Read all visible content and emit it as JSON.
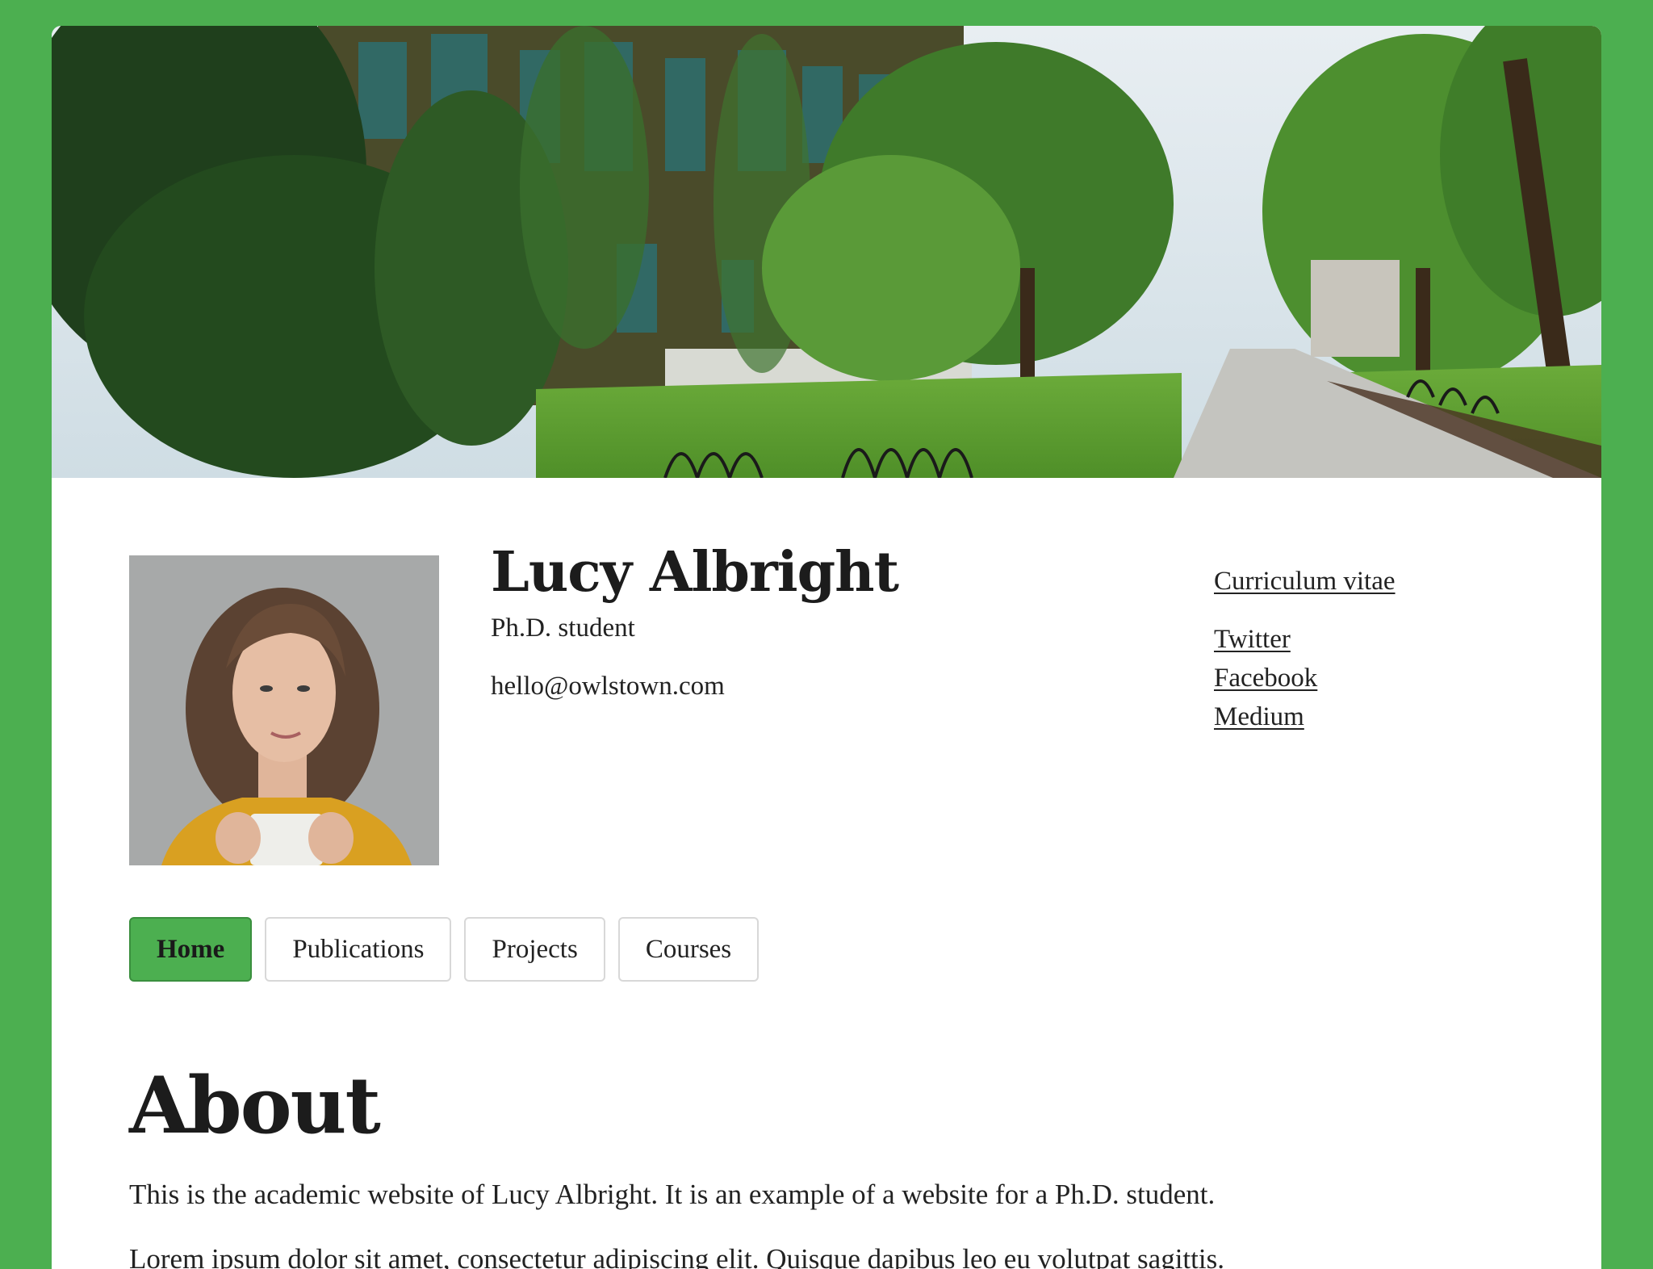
{
  "profile": {
    "name": "Lucy Albright",
    "role": "Ph.D. student",
    "email": "hello@owlstown.com"
  },
  "links": {
    "cv": "Curriculum vitae",
    "social": [
      "Twitter",
      "Facebook",
      "Medium"
    ]
  },
  "nav": {
    "tabs": [
      {
        "label": "Home",
        "active": true
      },
      {
        "label": "Publications",
        "active": false
      },
      {
        "label": "Projects",
        "active": false
      },
      {
        "label": "Courses",
        "active": false
      }
    ]
  },
  "about": {
    "heading": "About",
    "paragraph_1": "This is the academic website of Lucy Albright. It is an example of a website for a Ph.D. student.",
    "paragraph_2": "Lorem ipsum dolor sit amet, consectetur adipiscing elit. Quisque dapibus leo eu volutpat sagittis."
  },
  "colors": {
    "page_background": "#4caf50",
    "active_tab": "#4caf50",
    "text": "#222222"
  }
}
